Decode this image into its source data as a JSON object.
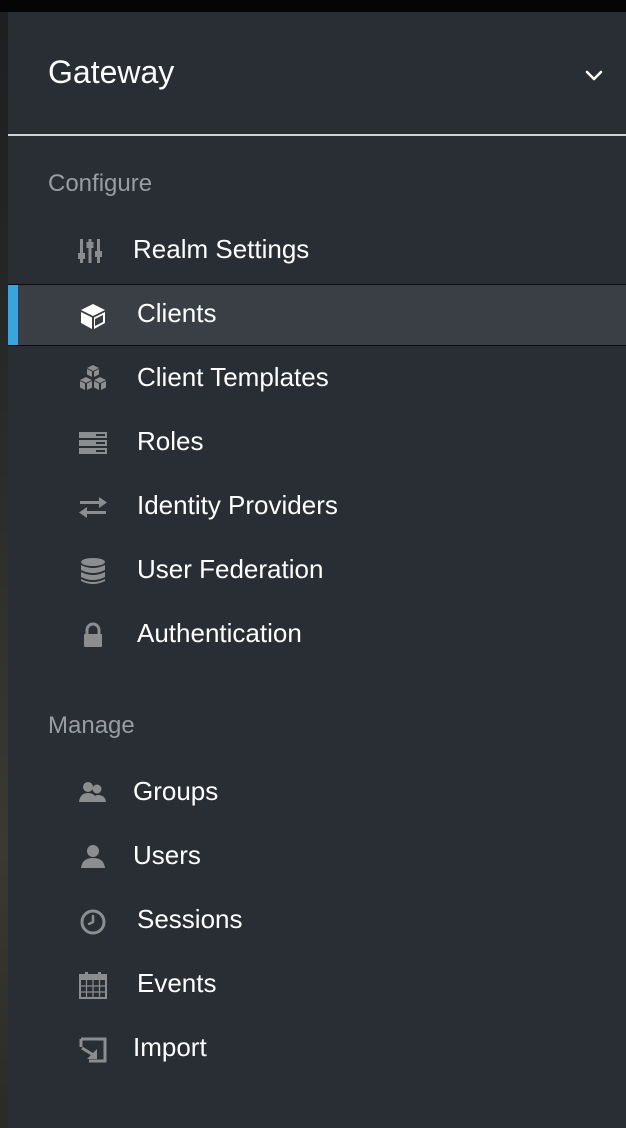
{
  "realm": {
    "name": "Gateway",
    "caret_icon": "chevron-down-icon"
  },
  "sections": {
    "configure": {
      "title": "Configure",
      "items": [
        {
          "label": "Realm Settings",
          "icon": "sliders-icon",
          "active": false
        },
        {
          "label": "Clients",
          "icon": "cube-icon",
          "active": true
        },
        {
          "label": "Client Templates",
          "icon": "cubes-icon",
          "active": false
        },
        {
          "label": "Roles",
          "icon": "list-icon",
          "active": false
        },
        {
          "label": "Identity Providers",
          "icon": "exchange-icon",
          "active": false
        },
        {
          "label": "User Federation",
          "icon": "database-icon",
          "active": false
        },
        {
          "label": "Authentication",
          "icon": "lock-icon",
          "active": false
        }
      ]
    },
    "manage": {
      "title": "Manage",
      "items": [
        {
          "label": "Groups",
          "icon": "users-icon",
          "active": false
        },
        {
          "label": "Users",
          "icon": "user-icon",
          "active": false
        },
        {
          "label": "Sessions",
          "icon": "clock-icon",
          "active": false
        },
        {
          "label": "Events",
          "icon": "calendar-icon",
          "active": false
        },
        {
          "label": "Import",
          "icon": "import-icon",
          "active": false
        }
      ]
    }
  },
  "colors": {
    "sidebar_bg": "#292e34",
    "active_bg": "#393f44",
    "active_accent": "#39a5dc",
    "section_title": "#9a9c9f",
    "icon_gray": "#8b8d8f",
    "label": "#ffffff"
  }
}
